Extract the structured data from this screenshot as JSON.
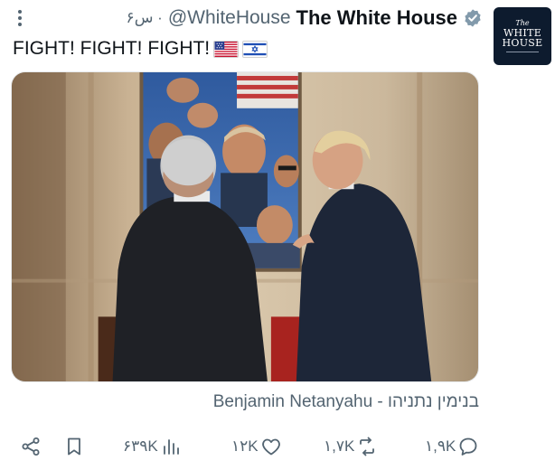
{
  "tweet": {
    "display_name": "The White House",
    "handle": "@WhiteHouse",
    "time": "۶س ·",
    "text": "FIGHT! FIGHT! FIGHT!",
    "flags": [
      "us-flag-emoji",
      "israel-flag-emoji"
    ],
    "media_caption": "Benjamin Netanyahu - בנימין נתניהו"
  },
  "avatar": {
    "line1": "The",
    "line2": "WHITE",
    "line3": "HOUSE"
  },
  "actions": {
    "replies": "۱,۹K",
    "reposts": "۱,۷K",
    "likes": "۱۲K",
    "views": "۶۳۹K"
  },
  "colors": {
    "text": "#0f1419",
    "muted": "#536471",
    "verified_badge": "#829aab",
    "avatar_bg": "#0d1b2e"
  },
  "icons": [
    "more-vertical-icon",
    "verified-badge-icon",
    "reply-icon",
    "repost-icon",
    "like-icon",
    "views-icon",
    "bookmark-icon",
    "share-icon"
  ]
}
